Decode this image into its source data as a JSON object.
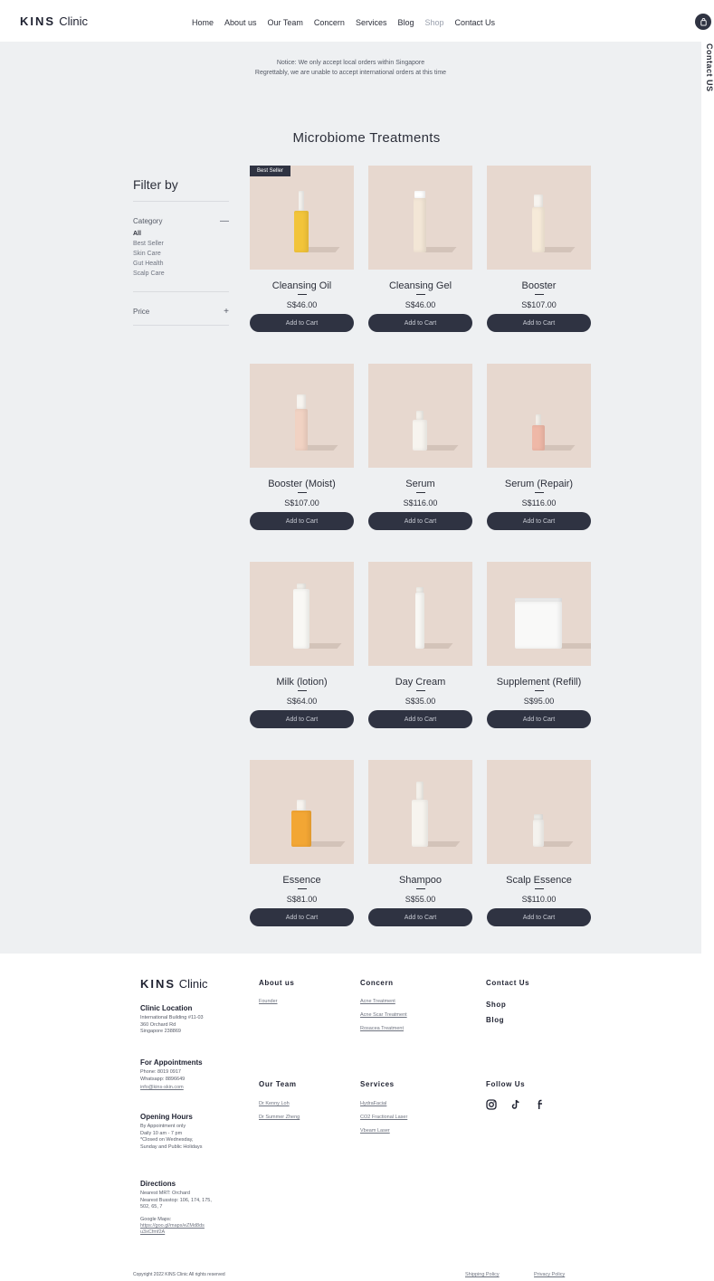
{
  "header": {
    "logo_strong": "KINS",
    "logo_light": "Clinic",
    "nav": [
      "Home",
      "About us",
      "Our Team",
      "Concern",
      "Services",
      "Blog",
      "Shop",
      "Contact Us"
    ],
    "active_nav": "Shop",
    "side_label": "Contact US"
  },
  "notice": {
    "line1": "Notice: We only accept local orders within Singapore",
    "line2": "Regrettably, we are unable to accept international orders at this time"
  },
  "section_title": "Microbiome Treatments",
  "filter": {
    "title": "Filter by",
    "category_label": "Category",
    "category_symbol": "—",
    "categories": [
      "All",
      "Best Seller",
      "Skin Care",
      "Gut Health",
      "Scalp Care"
    ],
    "selected_category": "All",
    "price_label": "Price",
    "price_symbol": "+"
  },
  "products": [
    {
      "name": "Cleansing Oil",
      "price": "S$46.00",
      "badge": "Best Seller",
      "button": "Add to Cart"
    },
    {
      "name": "Cleansing Gel",
      "price": "S$46.00",
      "badge": "",
      "button": "Add to Cart"
    },
    {
      "name": "Booster",
      "price": "S$107.00",
      "badge": "",
      "button": "Add to Cart"
    },
    {
      "name": "Booster (Moist)",
      "price": "S$107.00",
      "badge": "",
      "button": "Add to Cart"
    },
    {
      "name": "Serum",
      "price": "S$116.00",
      "badge": "",
      "button": "Add to Cart"
    },
    {
      "name": "Serum (Repair)",
      "price": "S$116.00",
      "badge": "",
      "button": "Add to Cart"
    },
    {
      "name": "Milk (lotion)",
      "price": "S$64.00",
      "badge": "",
      "button": "Add to Cart"
    },
    {
      "name": "Day Cream",
      "price": "S$35.00",
      "badge": "",
      "button": "Add to Cart"
    },
    {
      "name": "Supplement (Refill)",
      "price": "S$95.00",
      "badge": "",
      "button": "Add to Cart"
    },
    {
      "name": "Essence",
      "price": "S$81.00",
      "badge": "",
      "button": "Add to Cart"
    },
    {
      "name": "Shampoo",
      "price": "S$55.00",
      "badge": "",
      "button": "Add to Cart"
    },
    {
      "name": "Scalp Essence",
      "price": "S$110.00",
      "badge": "",
      "button": "Add to Cart"
    }
  ],
  "footer": {
    "logo_strong": "KINS",
    "logo_light": "Clinic",
    "clinic_location": {
      "heading": "Clinic Location",
      "lines": [
        "International Building #11-03",
        "360 Orchard Rd",
        "Singapore 238869"
      ]
    },
    "appointments": {
      "heading": "For Appointments",
      "phone": "Phone: 8019 0917",
      "whatsapp": "Whatsapp: 8896649",
      "email": "info@kins-skin.com"
    },
    "opening_hours": {
      "heading": "Opening Hours",
      "lines": [
        "By Appointment only",
        "Daily 10 am - 7 pm",
        "*Closed on Wednesday,",
        "Sunday and Public Holidays"
      ]
    },
    "directions": {
      "heading": "Directions",
      "lines": [
        "Nearest MRT: Orchard",
        "Nearest Busstop: 106, 174, 175,",
        "502, 65, 7"
      ],
      "maps_label": "Google Maps:",
      "maps_link_1": "https://goo.gl/maps/eZMd8ds",
      "maps_link_2": "u3xCfmf2A"
    },
    "about": {
      "heading": "About us",
      "links": [
        "Founder"
      ]
    },
    "concern": {
      "heading": "Concern",
      "links": [
        "Acne Treatment",
        "Acne Scar Treatment",
        "Rosacea Treatment"
      ]
    },
    "contact": {
      "heading": "Contact Us",
      "shop": "Shop",
      "blog": "Blog"
    },
    "team": {
      "heading": "Our Team",
      "links": [
        "Dr Kenny Loh",
        "Dr Summer Zheng"
      ]
    },
    "services": {
      "heading": "Services",
      "links": [
        "HydraFacial",
        "CO2 Fractional Laser",
        "Vbeam Laser"
      ]
    },
    "follow": {
      "heading": "Follow Us",
      "icons": [
        "instagram-icon",
        "tiktok-icon",
        "facebook-icon"
      ]
    },
    "copyright": "Copyright 2022 KINS Clinic All rights reserved",
    "shipping": "Shipping Policy",
    "privacy": "Privacy Policy"
  },
  "colors": {
    "dark": "#2f3342",
    "product_bg": "#e7d8cf",
    "page_bg": "#eef0f2"
  }
}
